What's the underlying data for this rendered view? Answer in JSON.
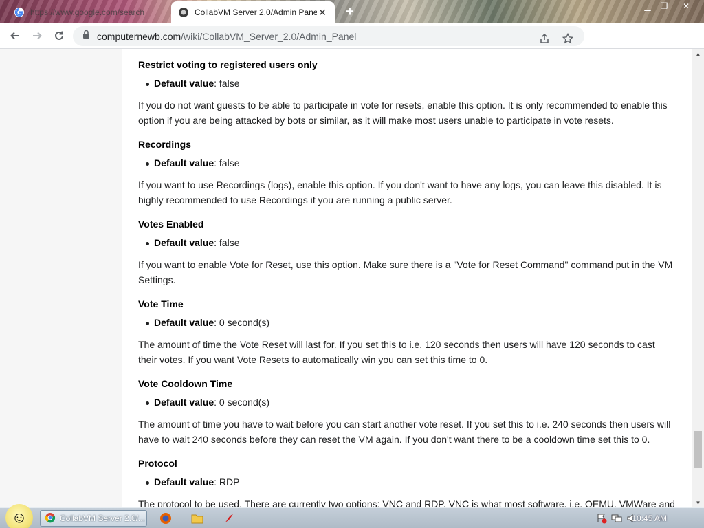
{
  "browser": {
    "tabs": [
      {
        "title": "https://www.google.com/search",
        "active": false,
        "favicon": "google-icon"
      },
      {
        "title": "CollabVM Server 2.0/Admin Panel",
        "active": true,
        "favicon": "collabvm-icon"
      }
    ],
    "address": {
      "host": "computernewb.com",
      "path": "/wiki/CollabVM_Server_2.0/Admin_Panel"
    }
  },
  "article": {
    "sections": [
      {
        "heading": "Restrict voting to registered users only",
        "default_label": "Default value",
        "default_value": ": false",
        "description": "If you do not want guests to be able to participate in vote for resets, enable this option. It is only recommended to enable this option if you are being attacked by bots or similar, as it will make most users unable to participate in vote resets."
      },
      {
        "heading": "Recordings",
        "default_label": "Default value",
        "default_value": ": false",
        "description": "If you want to use Recordings (logs), enable this option. If you don't want to have any logs, you can leave this disabled. It is highly recommended to use Recordings if you are running a public server."
      },
      {
        "heading": "Votes Enabled",
        "default_label": "Default value",
        "default_value": ": false",
        "description": "If you want to enable Vote for Reset, use this option. Make sure there is a \"Vote for Reset Command\" command put in the VM Settings."
      },
      {
        "heading": "Vote Time",
        "default_label": "Default value",
        "default_value": ": 0 second(s)",
        "description": "The amount of time the Vote Reset will last for. If you set this to i.e. 120 seconds then users will have 120 seconds to cast their votes. If you want Vote Resets to automatically win you can set this time to 0."
      },
      {
        "heading": "Vote Cooldown Time",
        "default_label": "Default value",
        "default_value": ": 0 second(s)",
        "description": "The amount of time you have to wait before you can start another vote reset. If you set this to i.e. 240 seconds then users will have to wait 240 seconds before they can reset the VM again. If you don't want there to be a cooldown time set this to 0."
      },
      {
        "heading": "Protocol",
        "default_label": "Default value",
        "default_value": ": RDP",
        "description": "The protocol to be used. There are currently two options: VNC and RDP. VNC is what most software, i.e. QEMU, VMWare and"
      }
    ]
  },
  "taskbar": {
    "task_label": "CollabVM Server 2.0/...",
    "clock": "10:45 AM"
  }
}
